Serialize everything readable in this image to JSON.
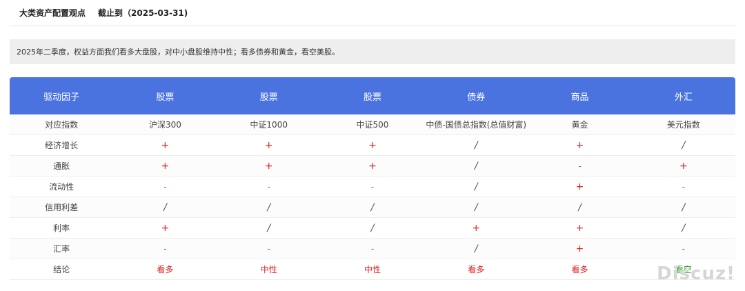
{
  "header": {
    "title": "大类资产配置观点",
    "as_of": "截止到（2025-03-31)"
  },
  "summary": "2025年二季度，权益方面我们看多大盘股，对中小盘股维持中性；看多债券和黄金，看空美股。",
  "table": {
    "headers": [
      "驱动因子",
      "股票",
      "股票",
      "股票",
      "债券",
      "商品",
      "外汇"
    ],
    "rows": [
      {
        "label": "对应指数",
        "cells": [
          {
            "text": "沪深300",
            "type": "text"
          },
          {
            "text": "中证1000",
            "type": "text"
          },
          {
            "text": "中证500",
            "type": "text"
          },
          {
            "text": "中债-国债总指数(总值财富)",
            "type": "text"
          },
          {
            "text": "黄金",
            "type": "text"
          },
          {
            "text": "美元指数",
            "type": "text"
          }
        ]
      },
      {
        "label": "经济增长",
        "cells": [
          {
            "text": "+",
            "type": "plus"
          },
          {
            "text": "+",
            "type": "plus"
          },
          {
            "text": "+",
            "type": "plus"
          },
          {
            "text": "/",
            "type": "neutral"
          },
          {
            "text": "+",
            "type": "plus"
          },
          {
            "text": "/",
            "type": "neutral"
          }
        ]
      },
      {
        "label": "通胀",
        "cells": [
          {
            "text": "+",
            "type": "plus"
          },
          {
            "text": "+",
            "type": "plus"
          },
          {
            "text": "+",
            "type": "plus"
          },
          {
            "text": "/",
            "type": "neutral"
          },
          {
            "text": "-",
            "type": "minus"
          },
          {
            "text": "+",
            "type": "plus"
          }
        ]
      },
      {
        "label": "流动性",
        "cells": [
          {
            "text": "-",
            "type": "minus"
          },
          {
            "text": "-",
            "type": "minus"
          },
          {
            "text": "-",
            "type": "minus"
          },
          {
            "text": "/",
            "type": "neutral"
          },
          {
            "text": "+",
            "type": "plus"
          },
          {
            "text": "-",
            "type": "minus"
          }
        ]
      },
      {
        "label": "信用利差",
        "cells": [
          {
            "text": "/",
            "type": "neutral"
          },
          {
            "text": "/",
            "type": "neutral"
          },
          {
            "text": "/",
            "type": "neutral"
          },
          {
            "text": "/",
            "type": "neutral"
          },
          {
            "text": "/",
            "type": "neutral"
          },
          {
            "text": "/",
            "type": "neutral"
          }
        ]
      },
      {
        "label": "利率",
        "cells": [
          {
            "text": "+",
            "type": "plus"
          },
          {
            "text": "/",
            "type": "neutral"
          },
          {
            "text": "/",
            "type": "neutral"
          },
          {
            "text": "+",
            "type": "plus"
          },
          {
            "text": "+",
            "type": "plus"
          },
          {
            "text": "/",
            "type": "neutral"
          }
        ]
      },
      {
        "label": "汇率",
        "cells": [
          {
            "text": "-",
            "type": "minus"
          },
          {
            "text": "-",
            "type": "minus"
          },
          {
            "text": "-",
            "type": "minus"
          },
          {
            "text": "/",
            "type": "neutral"
          },
          {
            "text": "+",
            "type": "plus"
          },
          {
            "text": "-",
            "type": "minus"
          }
        ]
      },
      {
        "label": "结论",
        "cells": [
          {
            "text": "看多",
            "type": "conclusion-red"
          },
          {
            "text": "中性",
            "type": "conclusion-red"
          },
          {
            "text": "中性",
            "type": "conclusion-red"
          },
          {
            "text": "看多",
            "type": "conclusion-red"
          },
          {
            "text": "看多",
            "type": "conclusion-red"
          },
          {
            "text": "看空",
            "type": "conclusion-green"
          }
        ]
      }
    ]
  },
  "watermark": "Discuz!",
  "colors": {
    "header_bg": "#4a73df",
    "positive": "#e02020",
    "negative": "#31a531",
    "summary_bg": "#eeeeef"
  }
}
